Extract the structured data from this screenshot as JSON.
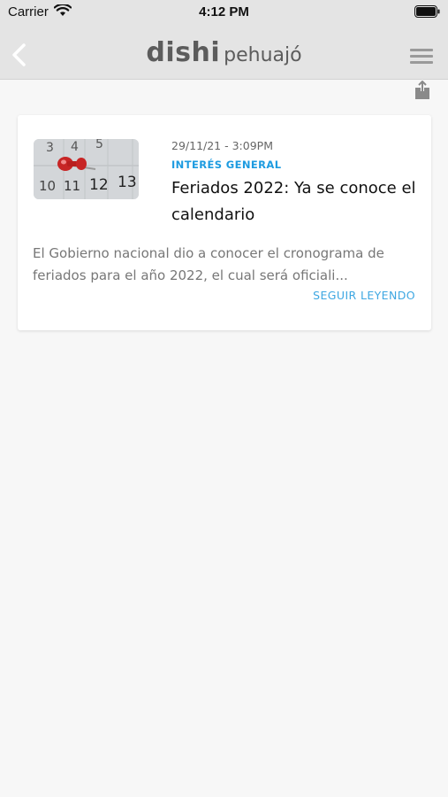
{
  "status_bar": {
    "carrier": "Carrier",
    "time": "4:12 PM"
  },
  "nav": {
    "logo_main": "dishi",
    "logo_sub": "pehuajó"
  },
  "article": {
    "date": "29/11/21 - 3:09PM",
    "category": "INTERÉS GENERAL",
    "title": "Feriados 2022: Ya se conoce el calendario",
    "excerpt": "El Gobierno nacional dio a conocer el cronograma de feriados para el año 2022, el cual será oficiali...",
    "read_more": "SEGUIR LEYENDO",
    "thumb_numbers_top": [
      "3",
      "4",
      "5"
    ],
    "thumb_numbers_bottom": [
      "10",
      "11",
      "12",
      "13"
    ]
  },
  "colors": {
    "accent": "#1d9be0",
    "bar_background": "#e4e4e4",
    "pin_red": "#d42a2a"
  }
}
